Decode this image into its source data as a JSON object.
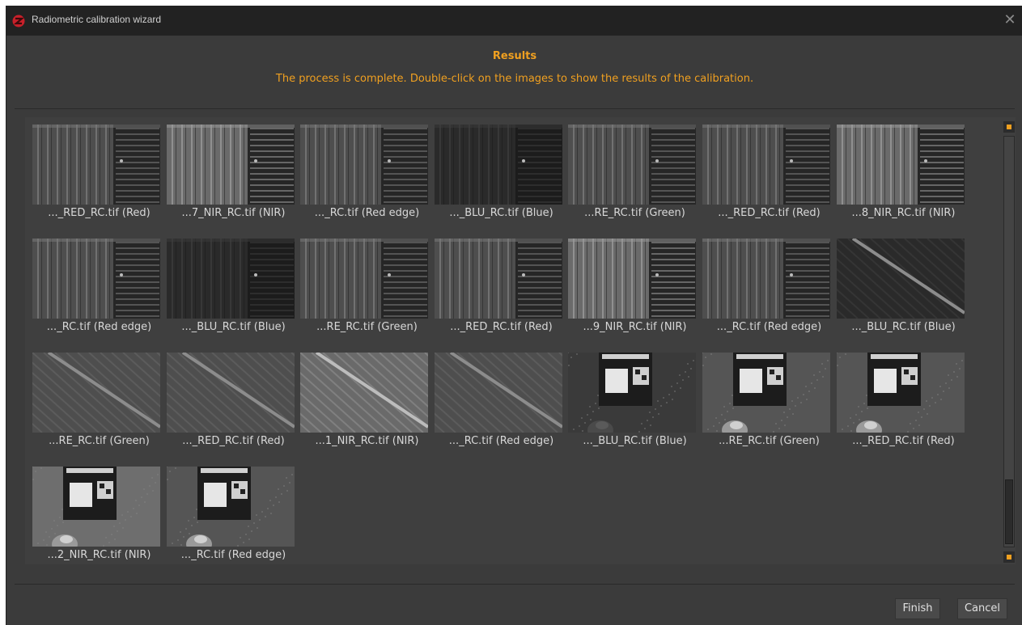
{
  "window": {
    "title": "Radiometric calibration wizard"
  },
  "header": {
    "title": "Results",
    "description": "The process is complete. Double-click on the images to show the results of the calibration."
  },
  "colors": {
    "accent": "#f0a020",
    "background": "#3b3b3b",
    "titlebar": "#222222"
  },
  "images": [
    {
      "label": "..._RED_RC.tif (Red)",
      "scene": "rows"
    },
    {
      "label": "...7_NIR_RC.tif (NIR)",
      "scene": "rows-bright"
    },
    {
      "label": "..._RC.tif (Red edge)",
      "scene": "rows"
    },
    {
      "label": "..._BLU_RC.tif (Blue)",
      "scene": "rows-dark"
    },
    {
      "label": "...RE_RC.tif (Green)",
      "scene": "rows"
    },
    {
      "label": "..._RED_RC.tif (Red)",
      "scene": "rows"
    },
    {
      "label": "...8_NIR_RC.tif (NIR)",
      "scene": "rows-bright"
    },
    {
      "label": "..._RC.tif (Red edge)",
      "scene": "rows"
    },
    {
      "label": "..._BLU_RC.tif (Blue)",
      "scene": "rows-dark"
    },
    {
      "label": "...RE_RC.tif (Green)",
      "scene": "rows"
    },
    {
      "label": "..._RED_RC.tif (Red)",
      "scene": "rows"
    },
    {
      "label": "...9_NIR_RC.tif (NIR)",
      "scene": "rows-bright"
    },
    {
      "label": "..._RC.tif (Red edge)",
      "scene": "rows"
    },
    {
      "label": "..._BLU_RC.tif (Blue)",
      "scene": "diag-dark"
    },
    {
      "label": "...RE_RC.tif (Green)",
      "scene": "diag"
    },
    {
      "label": "..._RED_RC.tif (Red)",
      "scene": "diag"
    },
    {
      "label": "...1_NIR_RC.tif (NIR)",
      "scene": "diag-bright"
    },
    {
      "label": "..._RC.tif (Red edge)",
      "scene": "diag"
    },
    {
      "label": "..._BLU_RC.tif (Blue)",
      "scene": "panel-dark"
    },
    {
      "label": "...RE_RC.tif (Green)",
      "scene": "panel"
    },
    {
      "label": "..._RED_RC.tif (Red)",
      "scene": "panel"
    },
    {
      "label": "...2_NIR_RC.tif (NIR)",
      "scene": "panel-bright"
    },
    {
      "label": "..._RC.tif (Red edge)",
      "scene": "panel"
    }
  ],
  "buttons": {
    "finish": "Finish",
    "cancel": "Cancel"
  }
}
